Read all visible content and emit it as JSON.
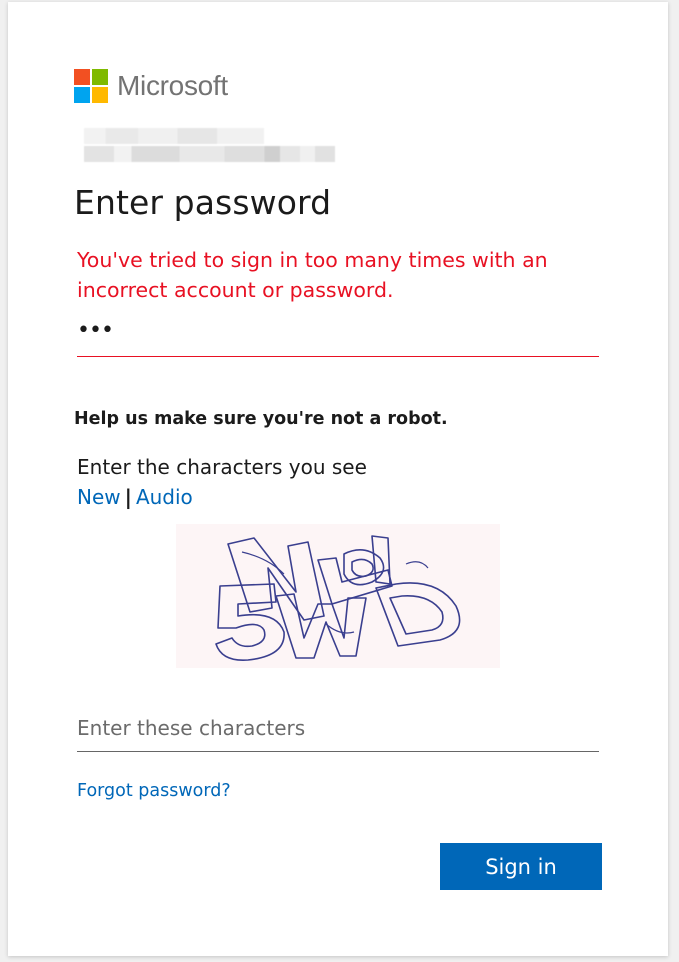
{
  "brand": {
    "name": "Microsoft",
    "logo_colors": [
      "#f25022",
      "#7fba00",
      "#00a4ef",
      "#ffb900"
    ]
  },
  "header": {
    "title": "Enter password"
  },
  "error": {
    "message": "You've tried to sign in too many times with an incorrect account or password.",
    "color": "#e81123"
  },
  "password": {
    "masked_value": "•••"
  },
  "captcha": {
    "heading": "Help us make sure you're not a robot.",
    "prompt": "Enter the characters you see",
    "new_label": "New",
    "separator": "|",
    "audio_label": "Audio",
    "input_placeholder": "Enter these characters",
    "input_value": ""
  },
  "links": {
    "forgot_password": "Forgot password?"
  },
  "actions": {
    "sign_in_label": "Sign in",
    "accent_color": "#0067b8"
  }
}
